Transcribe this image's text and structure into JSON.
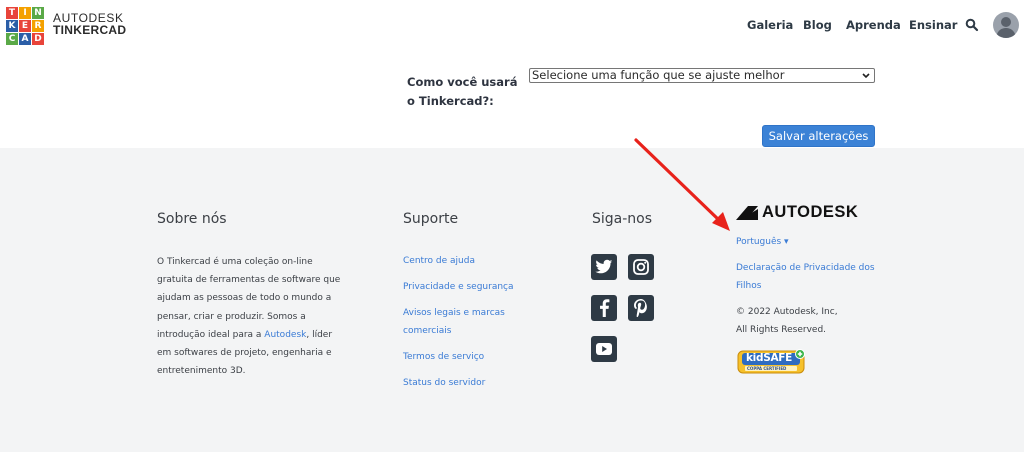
{
  "header": {
    "logo_letters": [
      "T",
      "I",
      "N",
      "K",
      "E",
      "R",
      "C",
      "A",
      "D"
    ],
    "logo_colors": [
      "#e8443a",
      "#f4a100",
      "#5aa947",
      "#2b5ea7",
      "#e8443a",
      "#f4a100",
      "#5aa947",
      "#2b5ea7",
      "#e8443a"
    ],
    "brand_line1": "AUTODESK",
    "brand_line2": "TINKERCAD",
    "nav": [
      "Galeria",
      "Blog",
      "Aprenda",
      "Ensinar"
    ]
  },
  "form": {
    "role_label_line1": "Como você usará",
    "role_label_line2": "o Tinkercad?:",
    "role_select_value": "Selecione uma função que se ajuste melhor",
    "save_label": "Salvar alterações"
  },
  "footer": {
    "about": {
      "heading": "Sobre nós",
      "text_before_link": "O Tinkercad é uma coleção on-line gratuita de ferramentas de software que ajudam as pessoas de todo o mundo a pensar, criar e produzir. Somos a introdução ideal para a ",
      "link": "Autodesk",
      "text_after_link": ", líder em softwares de projeto, engenharia e entretenimento 3D."
    },
    "support": {
      "heading": "Suporte",
      "links": [
        "Centro de ajuda",
        "Privacidade e segurança",
        "Avisos legais e marcas comerciais",
        "Termos de serviço",
        "Status do servidor"
      ]
    },
    "social": {
      "heading": "Siga-nos",
      "icons": [
        "twitter-icon",
        "instagram-icon",
        "facebook-icon",
        "pinterest-icon",
        "youtube-icon"
      ]
    },
    "autodesk": {
      "logo_text": "AUTODESK",
      "language": "Português ▾",
      "privacy_link": "Declaração de Privacidade dos Filhos",
      "copyright": "© 2022 Autodesk, Inc,",
      "rights": "All Rights Reserved.",
      "badge_text": "kidSAFE",
      "badge_subtext": "COPPA CERTIFIED"
    }
  },
  "colors": {
    "accent": "#3b82d6",
    "link": "#3a7bd5",
    "footer_bg": "#f3f4f5",
    "arrow": "#e8221b"
  }
}
